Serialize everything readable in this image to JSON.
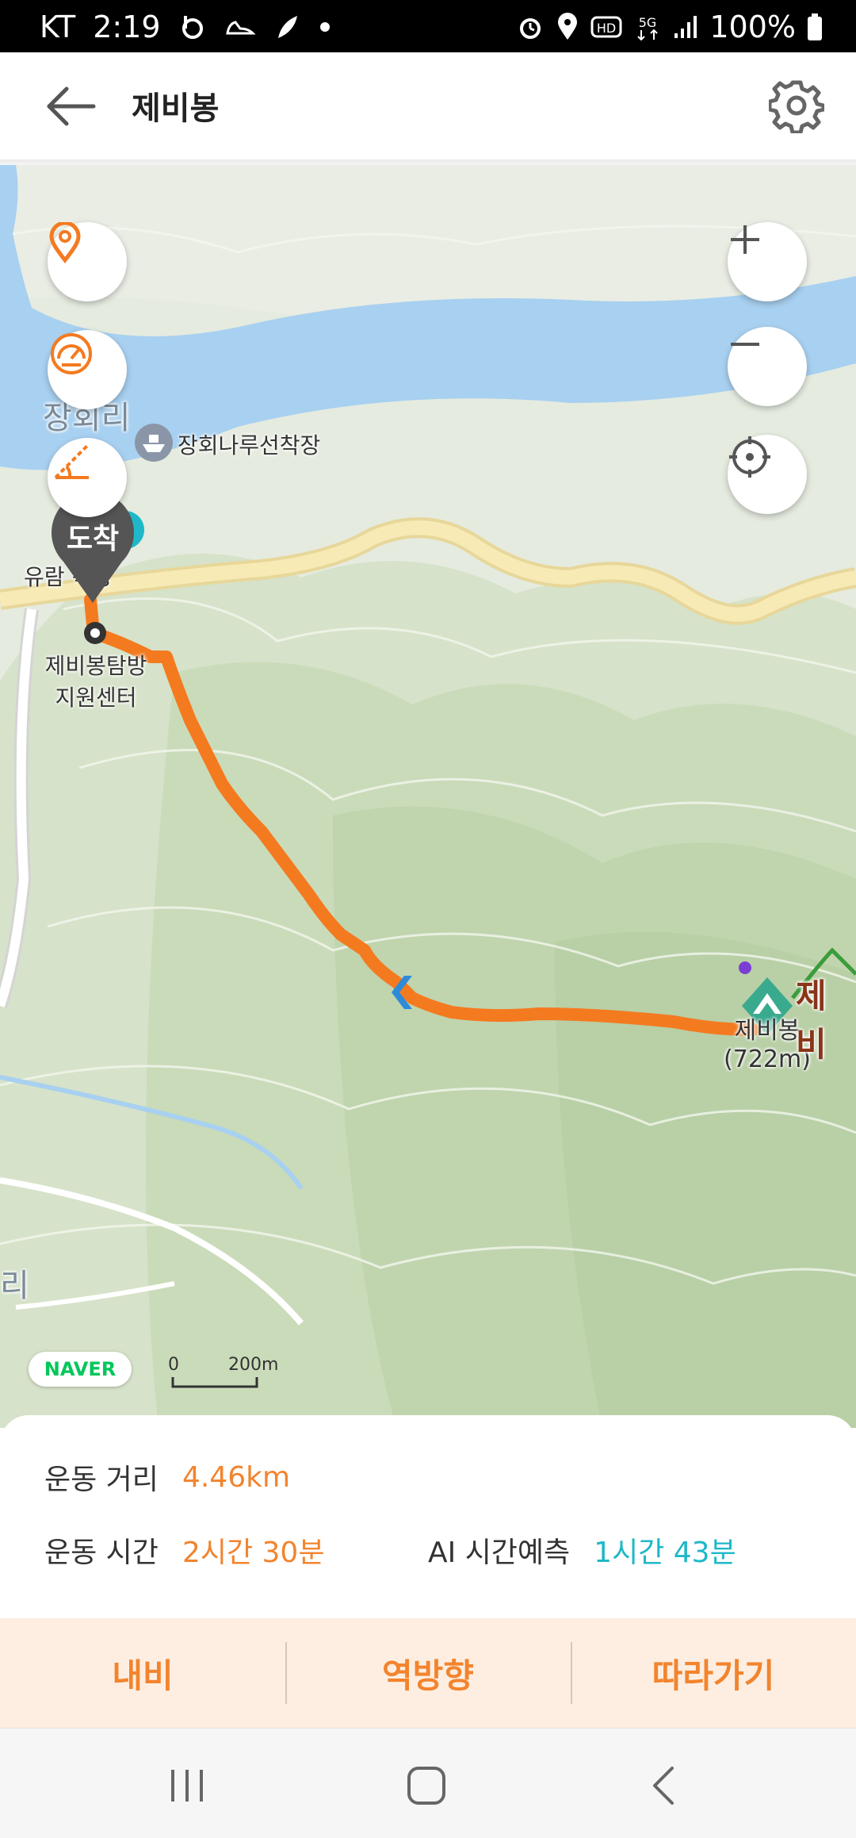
{
  "status_bar": {
    "carrier": "KT",
    "time": "2:19",
    "battery": "100%",
    "icons_left": [
      "b-app-icon",
      "shoe-icon",
      "feather-icon",
      "dot-icon"
    ],
    "icons_right": [
      "alarm-icon",
      "location-icon",
      "hd-icon",
      "5g-icon",
      "signal-icon",
      "battery-icon"
    ]
  },
  "header": {
    "title": "제비봉"
  },
  "map": {
    "labels": {
      "village_top": "장회리",
      "ferry": "장회나루선착장",
      "ferry_bottom": "유람    착장",
      "support_center_line1": "제비봉탐방",
      "support_center_line2": "지원센터",
      "peak_name": "제비봉",
      "peak_elevation": "(722m)",
      "peak_right": "제비",
      "village_bottom": "리"
    },
    "arrival_marker": "도착",
    "naver_logo": "NAVER",
    "scale_start": "0",
    "scale_end": "200m",
    "colors": {
      "route": "#f47a20",
      "water": "#a8d0f0",
      "road": "#f5e6a8"
    }
  },
  "info": {
    "distance_label": "운동 거리",
    "distance_value": "4.46km",
    "time_label": "운동 시간",
    "time_value": "2시간 30분",
    "ai_label": "AI 시간예측",
    "ai_value": "1시간 43분"
  },
  "actions": {
    "navi": "내비",
    "reverse": "역방향",
    "follow": "따라가기"
  }
}
